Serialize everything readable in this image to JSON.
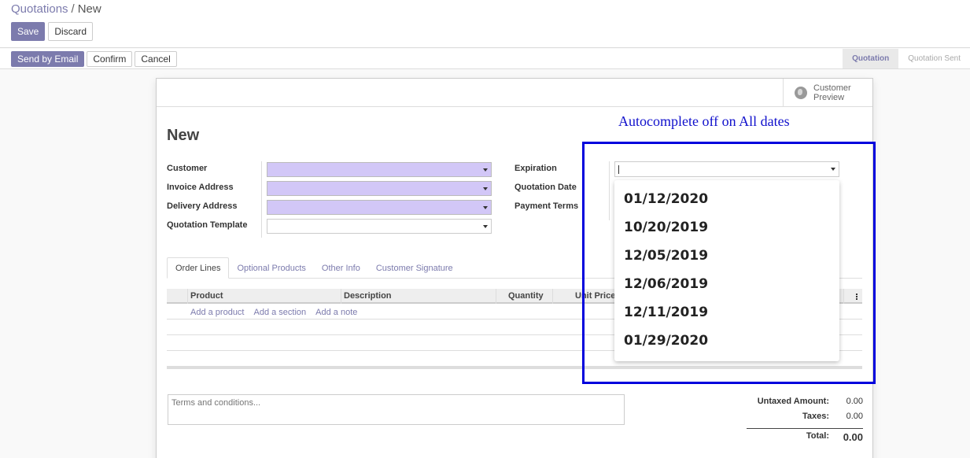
{
  "breadcrumb": {
    "parent": "Quotations",
    "separator": "/",
    "current": "New"
  },
  "control_buttons": {
    "save": "Save",
    "discard": "Discard"
  },
  "status_buttons": {
    "send_email": "Send by Email",
    "confirm": "Confirm",
    "cancel": "Cancel"
  },
  "stages": [
    {
      "label": "Quotation",
      "active": true
    },
    {
      "label": "Quotation Sent",
      "active": false
    }
  ],
  "smart_button": {
    "label_line1": "Customer",
    "label_line2": "Preview",
    "icon": "globe-icon"
  },
  "form": {
    "title": "New",
    "left_fields": [
      {
        "label": "Customer",
        "value": "",
        "required": true
      },
      {
        "label": "Invoice Address",
        "value": "",
        "required": true
      },
      {
        "label": "Delivery Address",
        "value": "",
        "required": true
      },
      {
        "label": "Quotation Template",
        "value": "",
        "required": false
      }
    ],
    "right_fields": [
      {
        "label": "Expiration",
        "value": ""
      },
      {
        "label": "Quotation Date",
        "value": ""
      },
      {
        "label": "Payment Terms",
        "value": ""
      }
    ]
  },
  "tabs": [
    {
      "label": "Order Lines",
      "active": true
    },
    {
      "label": "Optional Products",
      "active": false
    },
    {
      "label": "Other Info",
      "active": false
    },
    {
      "label": "Customer Signature",
      "active": false
    }
  ],
  "order_lines": {
    "columns": [
      "Product",
      "Description",
      "Quantity",
      "Unit Price"
    ],
    "add_links": [
      "Add a product",
      "Add a section",
      "Add a note"
    ]
  },
  "terms": {
    "placeholder": "Terms and conditions..."
  },
  "totals": {
    "untaxed_label": "Untaxed Amount:",
    "untaxed_value": "0.00",
    "taxes_label": "Taxes:",
    "taxes_value": "0.00",
    "total_label": "Total:",
    "total_value": "0.00"
  },
  "annotation": {
    "text": "Autocomplete off on All dates",
    "color": "#0000dd"
  },
  "autocomplete": [
    "01/12/2020",
    "10/20/2019",
    "12/05/2019",
    "12/06/2019",
    "12/11/2019",
    "01/29/2020"
  ],
  "colors": {
    "accent": "#7c7bad",
    "required_field": "#d2c7f7"
  }
}
